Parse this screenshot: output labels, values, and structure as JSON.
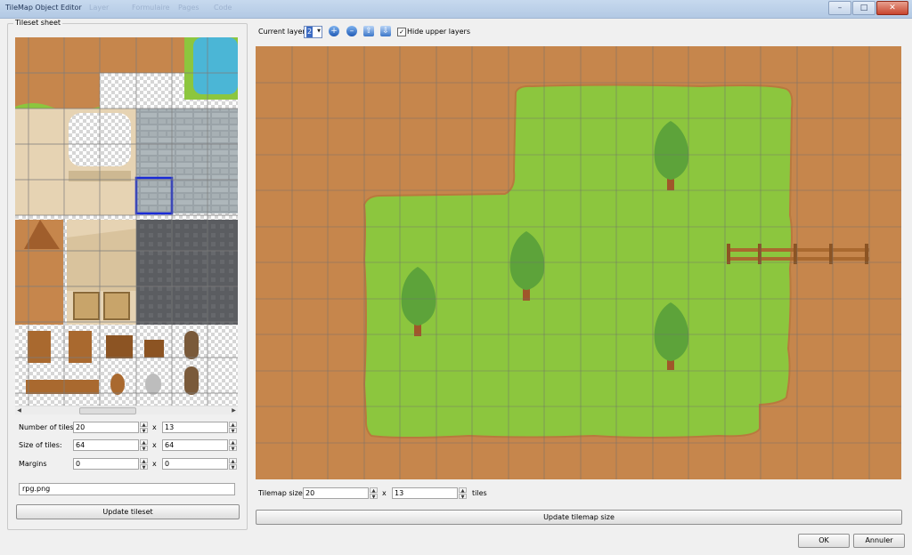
{
  "window": {
    "title": "TileMap Object Editor",
    "ghost_menu": [
      "Layer",
      "Formulaire",
      "Pages",
      "Code"
    ]
  },
  "tileset": {
    "group_label": "Tileset sheet",
    "number_of_tiles_label": "Number of tiles:",
    "number_of_tiles_x": "20",
    "number_of_tiles_y": "13",
    "size_of_tiles_label": "Size of tiles:",
    "size_of_tiles_x": "64",
    "size_of_tiles_y": "64",
    "margins_label": "Margins",
    "margins_x": "0",
    "margins_y": "0",
    "times_sign": "x",
    "image_file": "rpg.png",
    "update_button": "Update tileset"
  },
  "toolbar": {
    "current_layer_label": "Current layer:",
    "current_layer_value": "2",
    "hide_upper_layers_label": "Hide upper layers",
    "hide_upper_layers_checked": true
  },
  "tilemap": {
    "size_label": "Tilemap size:",
    "size_x": "20",
    "size_y": "13",
    "times_sign": "x",
    "units": "tiles",
    "update_button": "Update tilemap size"
  },
  "dialog": {
    "ok_button": "OK",
    "cancel_button": "Annuler"
  },
  "colors": {
    "dirt": "#c6864c",
    "grass": "#8cc63e",
    "grid": "#6f6f6f",
    "selection": "#1a2bd6"
  }
}
